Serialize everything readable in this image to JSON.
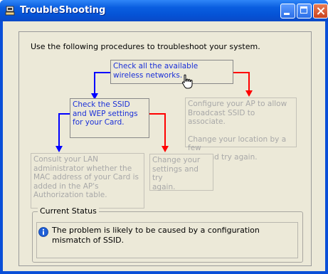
{
  "window": {
    "title": "TroubleShooting"
  },
  "intro_text": "Use the following procedures to troubleshoot your system.",
  "steps": {
    "check_networks": {
      "line1": "Check all the available",
      "line2": "wireless networks."
    },
    "check_ssid": {
      "line1": "Check the SSID",
      "line2": "and WEP settings",
      "line3": "for your Card."
    },
    "configure_ap": {
      "line1": "Configure your AP to allow",
      "line2": "Broadcast SSID to associate.",
      "line3": "Change your location by a few",
      "line4": "feet and try again."
    },
    "consult_admin": {
      "line1": "Consult your LAN",
      "line2": "administrator whether the",
      "line3": "MAC address of your Card is",
      "line4": "added in the AP's",
      "line5": "Authorization table."
    },
    "change_settings": {
      "line1": "Change your",
      "line2": "settings and try",
      "line3": "again."
    }
  },
  "status": {
    "label": "Current Status",
    "message": "The problem is likely to be caused by a configuration mismatch of SSID."
  },
  "colors": {
    "titlebar": "#0a5ee0",
    "active_text": "#1a2fd8",
    "inactive_text": "#a8a8a8",
    "yes_arrow": "#ff0000",
    "no_arrow": "#0000ff",
    "window_bg": "#ece9d8"
  },
  "icons": {
    "app": "network-icon",
    "info": "info-icon",
    "cursor": "hand-cursor-icon"
  }
}
